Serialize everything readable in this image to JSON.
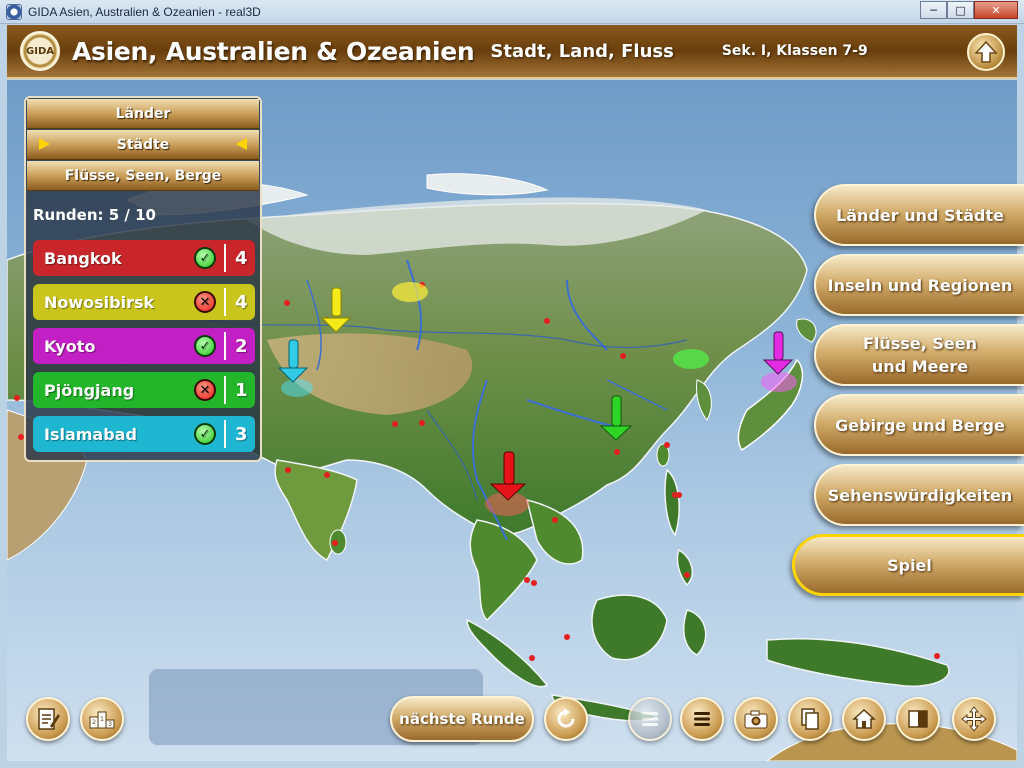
{
  "window": {
    "title": "GIDA Asien, Australien & Ozeanien - real3D"
  },
  "header": {
    "logo_text": "GIDA",
    "title": "Asien, Australien & Ozeanien",
    "subtitle": "Stadt, Land, Fluss",
    "level": "Sek. I, Klassen 7-9"
  },
  "panel": {
    "tabs": [
      {
        "label": "Länder"
      },
      {
        "label": "Städte"
      },
      {
        "label": "Flüsse, Seen, Berge"
      }
    ],
    "rounds_label": "Runden: 5 / 10",
    "rows": [
      {
        "name": "Bangkok",
        "result": "correct",
        "score": "4",
        "color": "#c8262a"
      },
      {
        "name": "Nowosibirsk",
        "result": "wrong",
        "score": "4",
        "color": "#c9c51d"
      },
      {
        "name": "Kyoto",
        "result": "correct",
        "score": "2",
        "color": "#c21fc4"
      },
      {
        "name": "Pjöngjang",
        "result": "wrong",
        "score": "1",
        "color": "#23b52a"
      },
      {
        "name": "Islamabad",
        "result": "correct",
        "score": "3",
        "color": "#1fb6d2"
      }
    ]
  },
  "menu": [
    {
      "label": "Länder und Städte"
    },
    {
      "label": "Inseln und Regionen"
    },
    {
      "label": "Flüsse, Seen und Meere",
      "line1": "Flüsse, Seen",
      "line2": "und Meere"
    },
    {
      "label": "Gebirge und Berge"
    },
    {
      "label": "Sehenswürdigkeiten"
    },
    {
      "label": "Spiel"
    }
  ],
  "bottom": {
    "next_round_label": "nächste Runde"
  },
  "icons": {
    "ok": "check-icon",
    "bad": "cross-icon"
  },
  "colors": {
    "accent_gold": "#c99a4f",
    "highlight": "#ffd400"
  }
}
